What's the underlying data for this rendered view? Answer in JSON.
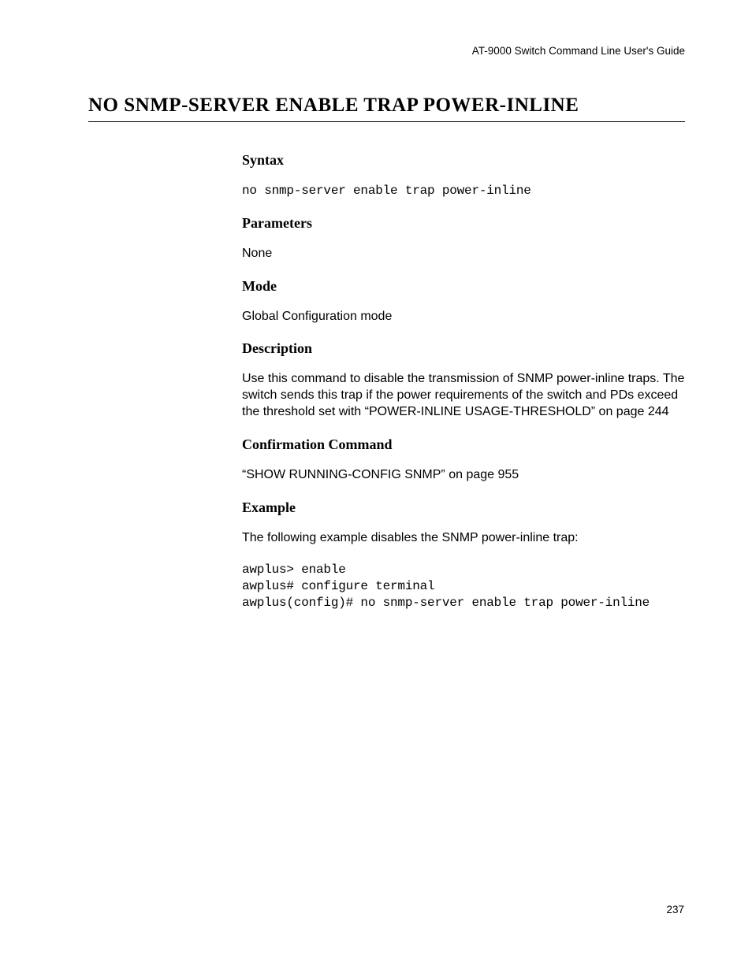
{
  "header": {
    "guide_title": "AT-9000 Switch Command Line User's Guide"
  },
  "title": "NO SNMP-SERVER ENABLE TRAP POWER-INLINE",
  "sections": {
    "syntax": {
      "heading": "Syntax",
      "code": "no snmp-server enable trap power-inline"
    },
    "parameters": {
      "heading": "Parameters",
      "text": "None"
    },
    "mode": {
      "heading": "Mode",
      "text": "Global Configuration mode"
    },
    "description": {
      "heading": "Description",
      "text": "Use this command to disable the transmission of SNMP power-inline traps. The switch sends this trap if the power requirements of the switch and PDs exceed the threshold set with “POWER-INLINE USAGE-THRESHOLD” on page 244"
    },
    "confirmation": {
      "heading": "Confirmation Command",
      "text": "“SHOW RUNNING-CONFIG SNMP” on page 955"
    },
    "example": {
      "heading": "Example",
      "text": "The following example disables the SNMP power-inline trap:",
      "code": "awplus> enable\nawplus# configure terminal\nawplus(config)# no snmp-server enable trap power-inline"
    }
  },
  "page_number": "237"
}
